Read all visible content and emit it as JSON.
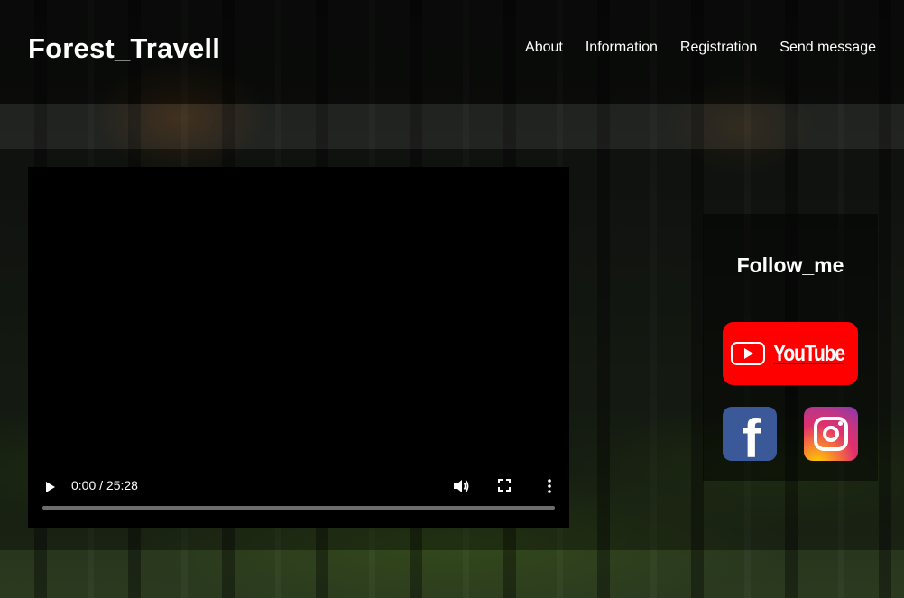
{
  "header": {
    "logo": "Forest_Travell",
    "nav": [
      "About",
      "Information",
      "Registration",
      "Send message"
    ]
  },
  "video": {
    "time": "0:00 / 25:28",
    "progress_fraction": 0
  },
  "follow": {
    "title": "Follow_me",
    "youtube_label": "YouTube",
    "facebook_glyph": "f",
    "icons": [
      "youtube-icon",
      "facebook-icon",
      "instagram-icon"
    ]
  },
  "colors": {
    "youtube": "#ff0000",
    "facebook": "#3b5998",
    "video_bg": "#000000"
  }
}
